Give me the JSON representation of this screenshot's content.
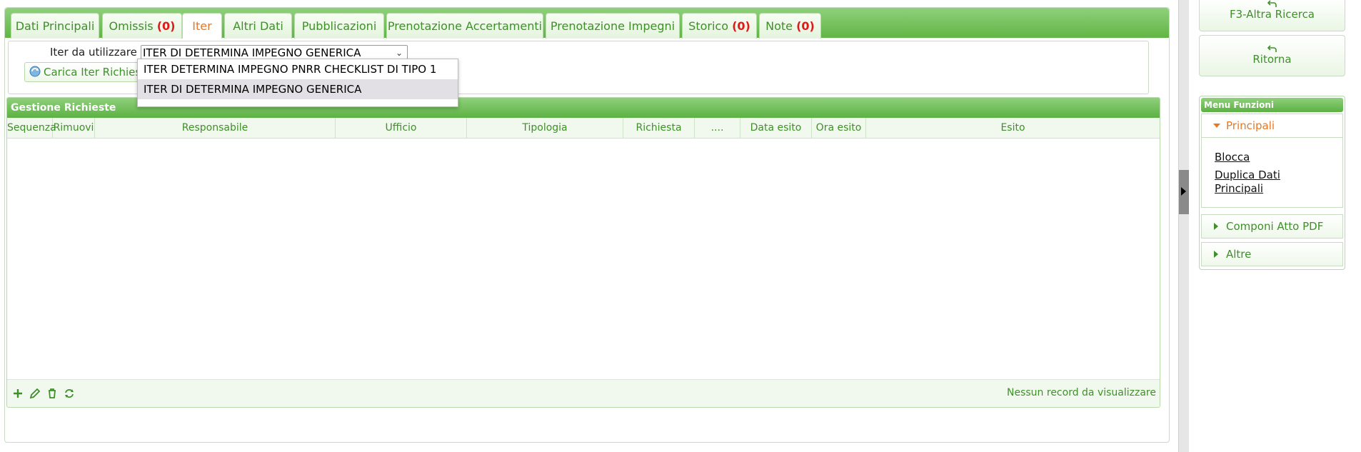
{
  "tabs": [
    {
      "label": "Dati Principali",
      "count": ""
    },
    {
      "label": "Omissis ",
      "count": "(0)"
    },
    {
      "label": "Iter",
      "count": ""
    },
    {
      "label": "Altri Dati",
      "count": ""
    },
    {
      "label": "Pubblicazioni",
      "count": ""
    },
    {
      "label": "Prenotazione Accertamenti",
      "count": ""
    },
    {
      "label": "Prenotazione Impegni",
      "count": ""
    },
    {
      "label": "Storico ",
      "count": "(0)"
    },
    {
      "label": "Note ",
      "count": "(0)"
    }
  ],
  "iter": {
    "label": "Iter da utilizzare",
    "selected": "ITER DI DETERMINA IMPEGNO GENERICA",
    "options": [
      "ITER DETERMINA IMPEGNO PNRR CHECKLIST DI TIPO 1",
      "ITER DI DETERMINA IMPEGNO GENERICA"
    ],
    "load_button": "Carica Iter Richieste"
  },
  "grid": {
    "title": "Gestione Richieste",
    "columns": [
      "Sequenza",
      "Rimuovi",
      "Responsabile",
      "Ufficio",
      "Tipologia",
      "Richiesta",
      "....",
      "Data esito",
      "Ora esito",
      "Esito"
    ],
    "empty_text": "Nessun record da visualizzare"
  },
  "sidebar": {
    "other_search": "F3-Altra Ricerca",
    "back": "Ritorna",
    "menu_title": "Menu Funzioni",
    "sections": [
      {
        "label": "Principali",
        "items": [
          "Blocca",
          "Duplica Dati Principali"
        ]
      },
      {
        "label": "Componi Atto PDF"
      },
      {
        "label": "Altre"
      }
    ]
  },
  "colors": {
    "accent": "#62b545",
    "active_tab": "#e87722",
    "count": "#e0191b"
  }
}
